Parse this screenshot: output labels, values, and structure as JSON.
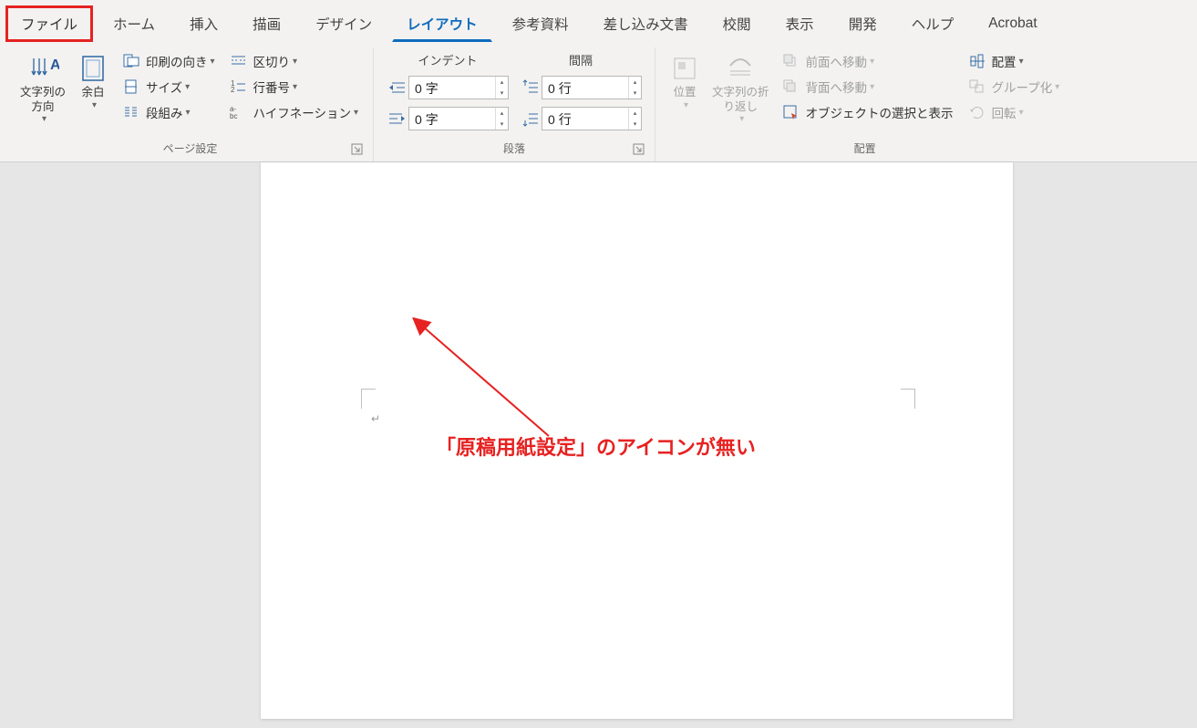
{
  "tabs": {
    "file": "ファイル",
    "home": "ホーム",
    "insert": "挿入",
    "draw": "描画",
    "design": "デザイン",
    "layout": "レイアウト",
    "references": "参考資料",
    "mailings": "差し込み文書",
    "review": "校閲",
    "view": "表示",
    "developer": "開発",
    "help": "ヘルプ",
    "acrobat": "Acrobat"
  },
  "page_setup": {
    "text_direction": "文字列の\n方向",
    "margins": "余白",
    "orientation": "印刷の向き",
    "size": "サイズ",
    "columns": "段組み",
    "breaks": "区切り",
    "line_numbers": "行番号",
    "hyphenation": "ハイフネーション",
    "group_label": "ページ設定"
  },
  "paragraph": {
    "indent_label": "インデント",
    "spacing_label": "間隔",
    "indent_left": "0 字",
    "indent_right": "0 字",
    "spacing_before": "0 行",
    "spacing_after": "0 行",
    "group_label": "段落"
  },
  "arrange": {
    "position": "位置",
    "wrap_text": "文字列の折\nり返し",
    "bring_forward": "前面へ移動",
    "send_backward": "背面へ移動",
    "selection_pane": "オブジェクトの選択と表示",
    "align": "配置",
    "group": "グループ化",
    "rotate": "回転",
    "group_label": "配置"
  },
  "annotation": {
    "text": "「原稿用紙設定」のアイコンが無い"
  }
}
